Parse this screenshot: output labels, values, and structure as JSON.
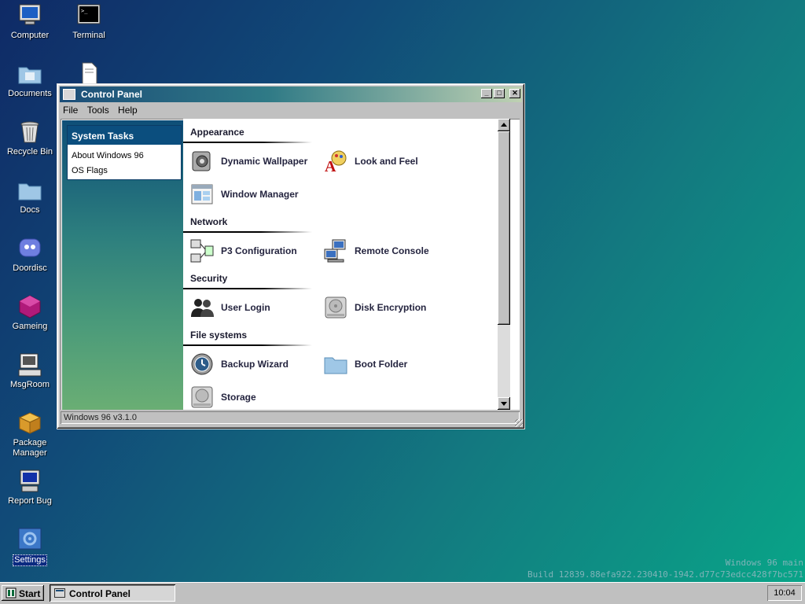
{
  "desktop": {
    "icons": [
      {
        "label": "Computer",
        "icon": "computer-icon"
      },
      {
        "label": "Terminal",
        "icon": "terminal-icon"
      },
      {
        "label": "Documents",
        "icon": "folder-icon"
      },
      {
        "label": "Recycle Bin",
        "icon": "recycle-bin-icon"
      },
      {
        "label": "Docs",
        "icon": "folder-icon"
      },
      {
        "label": "Doordisc",
        "icon": "chat-app-icon"
      },
      {
        "label": "Gameing",
        "icon": "game-cube-icon"
      },
      {
        "label": "MsgRoom",
        "icon": "message-room-icon"
      },
      {
        "label": "Package Manager",
        "icon": "package-icon"
      },
      {
        "label": "Report Bug",
        "icon": "bug-report-icon"
      },
      {
        "label": "Settings",
        "icon": "settings-icon"
      }
    ],
    "watermark": {
      "line1": "Windows 96 main",
      "line2": "Build 12839.88efa922.230410-1942.d77c73edcc428f7bc571"
    }
  },
  "window": {
    "title": "Control Panel",
    "menu": [
      "File",
      "Tools",
      "Help"
    ],
    "sidebar": {
      "heading": "System Tasks",
      "links": [
        "About Windows 96",
        "OS Flags"
      ]
    },
    "sections": [
      {
        "title": "Appearance",
        "items": [
          {
            "label": "Dynamic Wallpaper",
            "icon": "speaker-icon"
          },
          {
            "label": "Look and Feel",
            "icon": "font-palette-icon"
          },
          {
            "label": "Window Manager",
            "icon": "window-layout-icon"
          }
        ]
      },
      {
        "title": "Network",
        "items": [
          {
            "label": "P3 Configuration",
            "icon": "network-icon"
          },
          {
            "label": "Remote Console",
            "icon": "remote-computers-icon"
          }
        ]
      },
      {
        "title": "Security",
        "items": [
          {
            "label": "User Login",
            "icon": "users-icon"
          },
          {
            "label": "Disk Encryption",
            "icon": "hard-disk-icon"
          }
        ]
      },
      {
        "title": "File systems",
        "items": [
          {
            "label": "Backup Wizard",
            "icon": "backup-clock-icon"
          },
          {
            "label": "Boot Folder",
            "icon": "folder-icon"
          },
          {
            "label": "Storage",
            "icon": "storage-disk-icon"
          }
        ]
      }
    ],
    "status": "Windows 96 v3.1.0"
  },
  "taskbar": {
    "start_label": "Start",
    "tasks": [
      "Control Panel"
    ],
    "clock": "10:04"
  }
}
